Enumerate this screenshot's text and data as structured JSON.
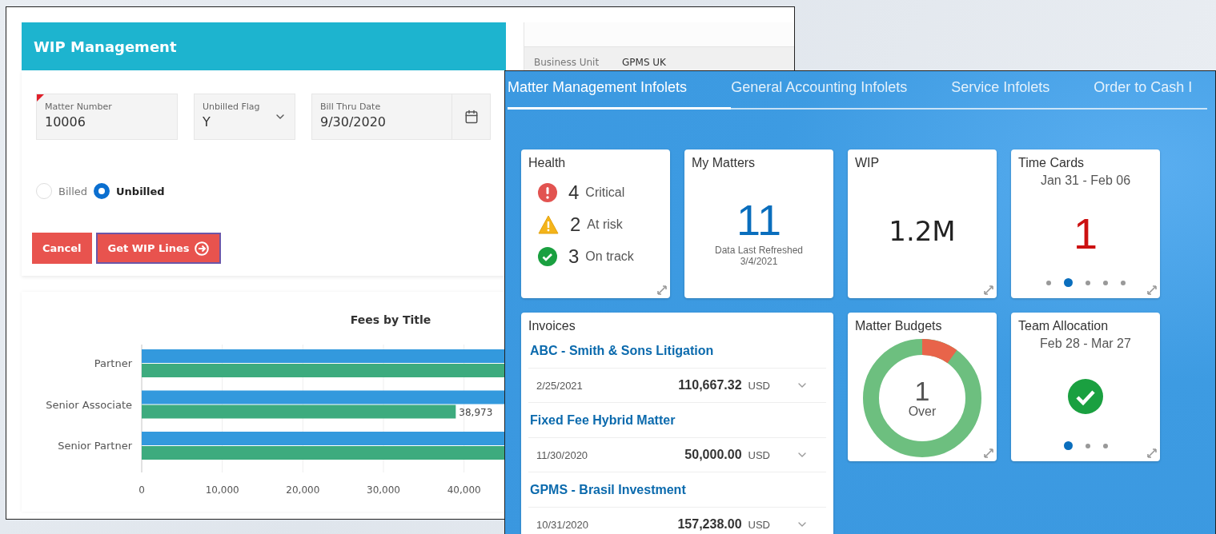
{
  "wip_window": {
    "title": "WIP Management",
    "fields": [
      {
        "kind": "text",
        "label": "Matter Number",
        "value": "10006",
        "required": true
      },
      {
        "kind": "select",
        "label": "Unbilled Flag",
        "value": "Y",
        "required": false
      },
      {
        "kind": "date",
        "label": "Bill Thru Date",
        "value": "9/30/2020",
        "required": false
      }
    ],
    "radios": [
      {
        "label": "Billed",
        "selected": false
      },
      {
        "label": "Unbilled",
        "selected": true
      }
    ],
    "buttons": [
      {
        "kind": "plain",
        "label": "Cancel"
      },
      {
        "kind": "arrow",
        "label": "Get WIP Lines"
      }
    ],
    "side_table": {
      "rows": [
        {
          "label": "Business Unit",
          "value": "GPMS UK"
        }
      ]
    },
    "chart_data": {
      "type": "bar",
      "orientation": "horizontal",
      "title": "Fees by Title",
      "categories": [
        "Partner",
        "Senior Associate",
        "Senior Partner"
      ],
      "series": [
        {
          "color": "#3399dd",
          "values": [
            45000,
            45000,
            45000
          ]
        },
        {
          "color": "#3dab7e",
          "values": [
            45000,
            38973,
            45000
          ]
        }
      ],
      "xlim": [
        0,
        45000
      ],
      "grid": true,
      "xticks": [
        {
          "value": 0,
          "label": "0"
        },
        {
          "value": 10000,
          "label": "10,000"
        },
        {
          "value": 20000,
          "label": "20,000"
        },
        {
          "value": 30000,
          "label": "30,000"
        },
        {
          "value": 40000,
          "label": "40,000"
        }
      ],
      "value_labels": [
        [
          null,
          null,
          null
        ],
        [
          null,
          "38,973",
          null
        ]
      ]
    }
  },
  "infolets_window": {
    "tabs": [
      {
        "label": "Matter Management Infolets",
        "selected": true
      },
      {
        "label": "General Accounting Infolets",
        "selected": false
      },
      {
        "label": "Service Infolets",
        "selected": false
      },
      {
        "label": "Order to Cash I",
        "selected": false
      }
    ],
    "tiles": [
      {
        "kind": "health",
        "title": "Health",
        "expandable": true,
        "items": [
          {
            "kind": "critical",
            "count": "4",
            "label": "Critical"
          },
          {
            "kind": "risk",
            "count": "2",
            "label": "At risk"
          },
          {
            "kind": "ok",
            "count": "3",
            "label": "On track"
          }
        ]
      },
      {
        "kind": "count",
        "title": "My Matters",
        "expandable": false,
        "value": "11",
        "note": "Data Last Refreshed",
        "date": "3/4/2021"
      },
      {
        "kind": "metric",
        "title": "WIP",
        "expandable": true,
        "value": "1.2M"
      },
      {
        "kind": "carousel",
        "title": "Time Cards",
        "subtitle": "Jan 31 - Feb 06",
        "expandable": true,
        "value": "1",
        "pages": [
          {
            "selected": false
          },
          {
            "selected": true
          },
          {
            "selected": false
          },
          {
            "selected": false
          },
          {
            "selected": false
          }
        ]
      },
      {
        "kind": "invoices",
        "title": "Invoices",
        "expandable": false,
        "items": [
          {
            "name": "ABC - Smith & Sons Litigation",
            "date": "2/25/2021",
            "amount": "110,667.32",
            "currency": "USD"
          },
          {
            "name": "Fixed Fee Hybrid Matter",
            "date": "11/30/2020",
            "amount": "50,000.00",
            "currency": "USD"
          },
          {
            "name": "GPMS - Brasil Investment",
            "date": "10/31/2020",
            "amount": "157,238.00",
            "currency": "USD"
          }
        ]
      },
      {
        "kind": "donut",
        "title": "Matter Budgets",
        "expandable": true,
        "value": "1",
        "caption": "Over"
      },
      {
        "kind": "allocation",
        "title": "Team Allocation",
        "subtitle": "Feb 28 - Mar 27",
        "expandable": true,
        "pages": [
          {
            "selected": true
          },
          {
            "selected": false
          },
          {
            "selected": false
          }
        ]
      }
    ]
  }
}
